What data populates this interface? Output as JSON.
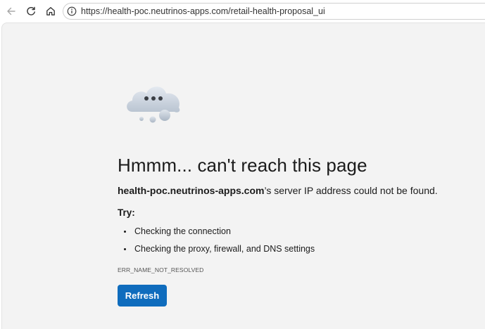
{
  "browser": {
    "url": "https://health-poc.neutrinos-apps.com/retail-health-proposal_ui",
    "icons": {
      "back": "back-arrow-icon",
      "reload": "reload-icon",
      "home": "home-icon",
      "site_info": "info-icon"
    }
  },
  "error_page": {
    "illustration": "cloud-icon",
    "headline": "Hmmm... can't reach this page",
    "host": "health-poc.neutrinos-apps.com",
    "message_suffix": "’s server IP address could not be found.",
    "try_label": "Try:",
    "suggestions": [
      "Checking the connection",
      "Checking the proxy, firewall, and DNS settings"
    ],
    "error_code": "ERR_NAME_NOT_RESOLVED",
    "refresh_label": "Refresh"
  },
  "colors": {
    "page_background": "#f3f3f3",
    "accent": "#0f6cbd"
  }
}
